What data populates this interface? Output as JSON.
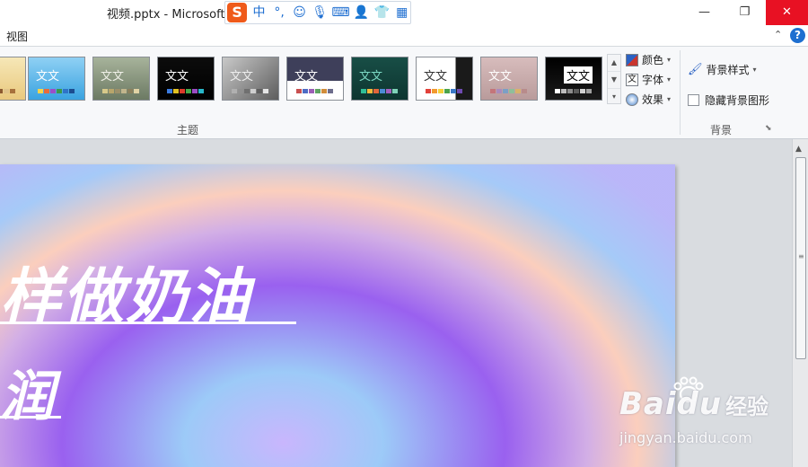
{
  "window": {
    "title": "视频.pptx - Microsoft P",
    "minimize_glyph": "—",
    "restore_glyph": "❐",
    "close_glyph": "✕"
  },
  "ime_bar": {
    "logo": "S",
    "items": [
      "中",
      "°,",
      "☺",
      "🎙",
      "⌨",
      "👤",
      "👕",
      "▦"
    ]
  },
  "ribbon_tab": {
    "active": "视图",
    "collapse_glyph": "⌃",
    "help_glyph": "?"
  },
  "themes": {
    "group_label": "主题",
    "items": [
      {
        "text": "",
        "bg": "linear-gradient(#f6e7b7,#e9c97e)",
        "fg": "#555"
      },
      {
        "text": "文文",
        "bg": "linear-gradient(#8fd0f4,#3aa3e0)",
        "fg": "#ffffff"
      },
      {
        "text": "文文",
        "bg": "linear-gradient(#a7b39b,#6c7a63)",
        "fg": "#f0f0e8"
      },
      {
        "text": "文文",
        "bg": "linear-gradient(#0c0c0c,#000000)",
        "fg": "#ffffff"
      },
      {
        "text": "文文",
        "bg": "linear-gradient(135deg,#c9c9c9,#5d5d5d)",
        "fg": "#eeeeee"
      },
      {
        "text": "文文",
        "bg": "linear-gradient(#3e3f5a 55%,#ffffff 55%)",
        "fg": "#ffffff"
      },
      {
        "text": "文文",
        "bg": "linear-gradient(#184e46,#0d3530)",
        "fg": "#7cd9c4"
      },
      {
        "text": "文文",
        "bg": "linear-gradient(90deg,#ffffff 70%,#1a1a1a 70%)",
        "fg": "#333333"
      },
      {
        "text": "文文",
        "bg": "linear-gradient(#d7bcbc,#b99b9b)",
        "fg": "#ffffff"
      },
      {
        "text": "文文",
        "bg": "linear-gradient(#000000,#1a1a1a)",
        "fg": "#000000"
      }
    ],
    "colors_label": "颜色",
    "fonts_label": "字体",
    "effects_label": "效果",
    "scroll_up": "▲",
    "scroll_down": "▼",
    "scroll_more": "▾"
  },
  "background": {
    "group_label": "背景",
    "style_label": "背景样式",
    "hide_label": "隐藏背景图形",
    "hide_checked": false
  },
  "slide": {
    "title_line1": "样做奶油",
    "title_line2": "润"
  },
  "scrollbar": {
    "up": "▲",
    "grip": "≡"
  },
  "watermark": {
    "brand": "Bai",
    "brand2": "du",
    "cn": "经验",
    "url": "jingyan.baidu.com"
  }
}
